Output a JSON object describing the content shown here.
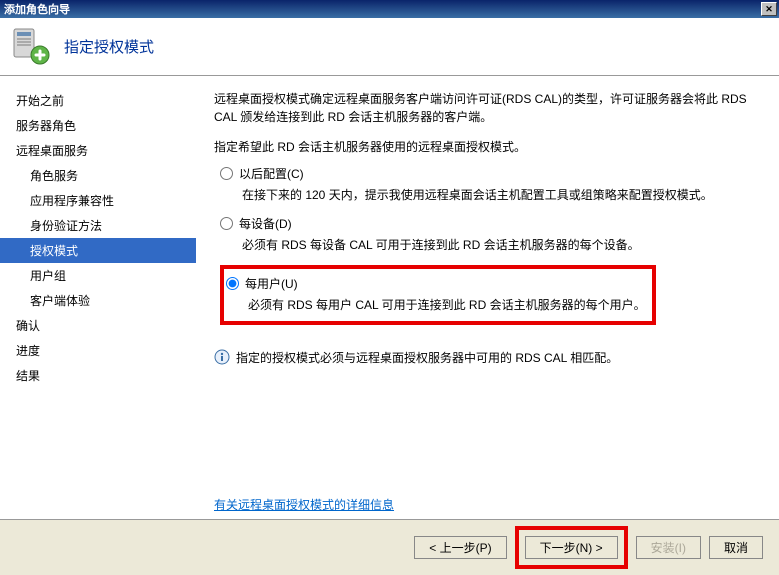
{
  "window": {
    "title": "添加角色向导"
  },
  "header": {
    "title": "指定授权模式"
  },
  "sidebar": {
    "items": [
      {
        "label": "开始之前",
        "indent": false
      },
      {
        "label": "服务器角色",
        "indent": false
      },
      {
        "label": "远程桌面服务",
        "indent": false,
        "group": true
      },
      {
        "label": "角色服务",
        "indent": true
      },
      {
        "label": "应用程序兼容性",
        "indent": true
      },
      {
        "label": "身份验证方法",
        "indent": true
      },
      {
        "label": "授权模式",
        "indent": true,
        "selected": true
      },
      {
        "label": "用户组",
        "indent": true
      },
      {
        "label": "客户端体验",
        "indent": true
      },
      {
        "label": "确认",
        "indent": false
      },
      {
        "label": "进度",
        "indent": false
      },
      {
        "label": "结果",
        "indent": false
      }
    ]
  },
  "main": {
    "desc": "远程桌面授权模式确定远程桌面服务客户端访问许可证(RDS CAL)的类型，许可证服务器会将此 RDS CAL 颁发给连接到此 RD 会话主机服务器的客户端。",
    "prompt": "指定希望此 RD 会话主机服务器使用的远程桌面授权模式。",
    "options": [
      {
        "label": "以后配置(C)",
        "desc": "在接下来的 120 天内，提示我使用远程桌面会话主机配置工具或组策略来配置授权模式。",
        "checked": false
      },
      {
        "label": "每设备(D)",
        "desc": "必须有 RDS 每设备 CAL 可用于连接到此 RD 会话主机服务器的每个设备。",
        "checked": false
      },
      {
        "label": "每用户(U)",
        "desc": "必须有 RDS 每用户 CAL 可用于连接到此 RD 会话主机服务器的每个用户。",
        "checked": true
      }
    ],
    "info": "指定的授权模式必须与远程桌面授权服务器中可用的 RDS CAL 相匹配。",
    "link": "有关远程桌面授权模式的详细信息"
  },
  "footer": {
    "prev": "< 上一步(P)",
    "next": "下一步(N) >",
    "install": "安装(I)",
    "cancel": "取消"
  }
}
